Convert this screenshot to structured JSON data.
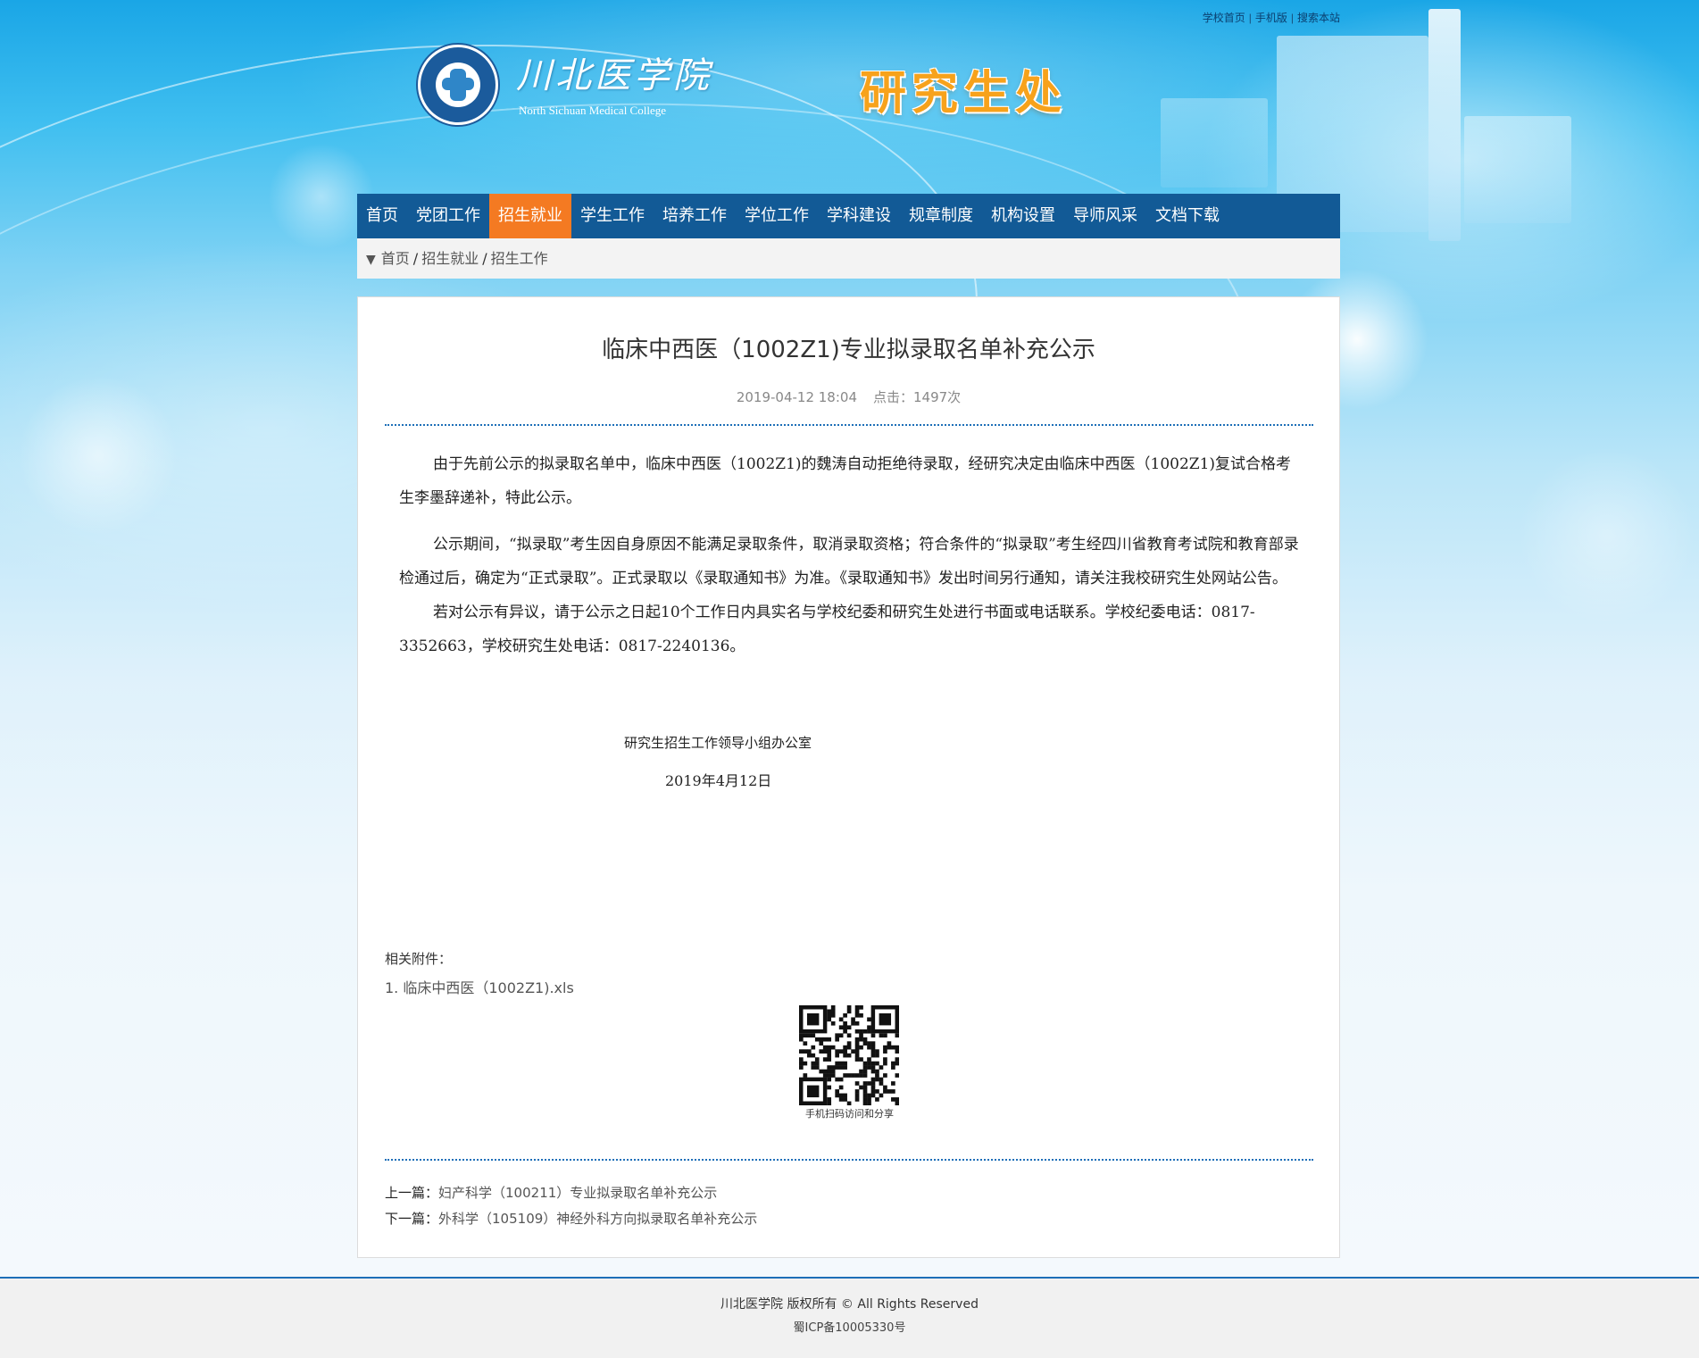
{
  "top_links": [
    "学校首页",
    "手机版",
    "搜索本站"
  ],
  "school": {
    "name_cn": "川北医学院",
    "name_en": "North Sichuan Medical College"
  },
  "department": "研究生处",
  "nav": {
    "items": [
      "首页",
      "党团工作",
      "招生就业",
      "学生工作",
      "培养工作",
      "学位工作",
      "学科建设",
      "规章制度",
      "机构设置",
      "导师风采",
      "文档下载"
    ],
    "active": "招生就业"
  },
  "breadcrumb": {
    "items": [
      "首页",
      "招生就业",
      "招生工作"
    ],
    "separator": "/"
  },
  "article": {
    "title": "临床中西医（1002Z1)专业拟录取名单补充公示",
    "date": "2019-04-12 18:04",
    "clicks": "点击：1497次",
    "paragraphs": [
      "由于先前公示的拟录取名单中，临床中西医（1002Z1)的魏涛自动拒绝待录取，经研究决定由临床中西医（1002Z1)复试合格考生李墨辞递补，特此公示。",
      "公示期间，“拟录取”考生因自身原因不能满足录取条件，取消录取资格；符合条件的“拟录取”考生经四川省教育考试院和教育部录检通过后，确定为“正式录取”。正式录取以《录取通知书》为准。《录取通知书》发出时间另行通知，请关注我校研究生处网站公告。",
      "若对公示有异议，请于公示之日起10个工作日内具实名与学校纪委和研究生处进行书面或电话联系。学校纪委电话：0817-3352663，学校研究生处电话：0817-2240136。"
    ],
    "signature_org": "研究生招生工作领导小组办公室",
    "signature_date": "2019年4月12日",
    "attachments_label": "相关附件：",
    "attachments": [
      "1. 临床中西医（1002Z1).xls"
    ],
    "qr_caption": "手机扫码访问和分享",
    "prev_label": "上一篇：",
    "prev_title": "妇产科学（100211）专业拟录取名单补充公示",
    "next_label": "下一篇：",
    "next_title": "外科学（105109）神经外科方向拟录取名单补充公示"
  },
  "footer": {
    "copyright": "川北医学院 版权所有 © All Rights Reserved",
    "icp": "蜀ICP备10005330号"
  },
  "colors": {
    "nav_bg": "#125a96",
    "nav_active": "#f47a22",
    "dept_title": "#f7a21b",
    "divider": "#1d6fb8"
  }
}
